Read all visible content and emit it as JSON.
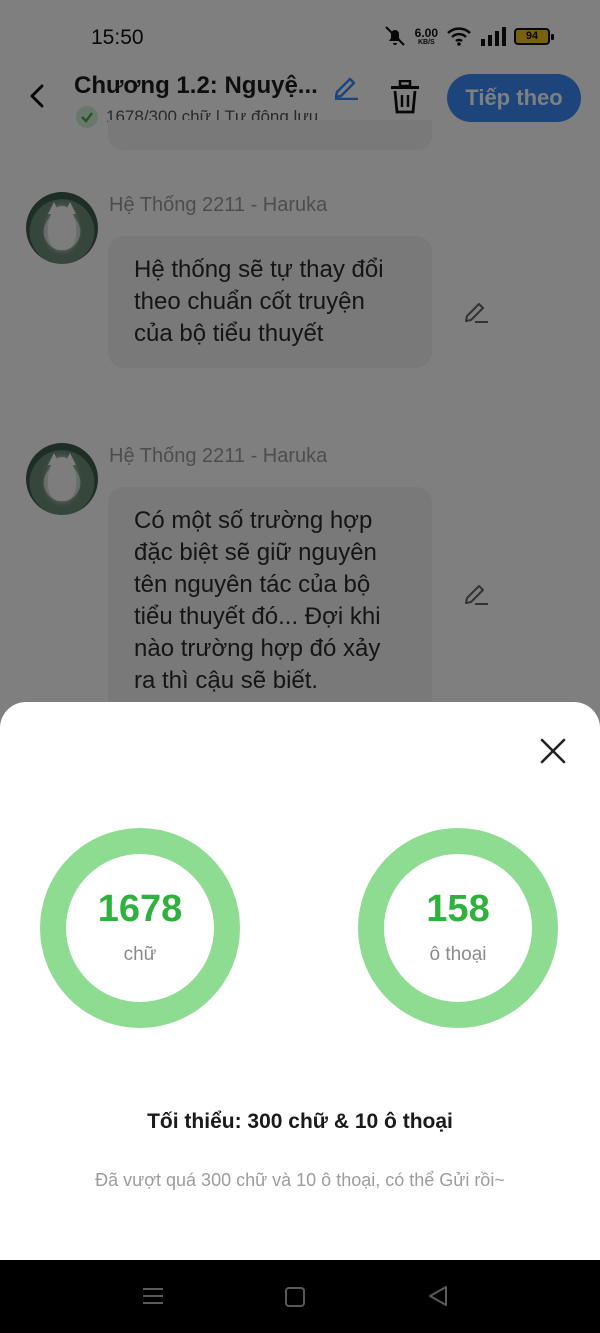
{
  "status_bar": {
    "time": "15:50",
    "net_speed_value": "6.00",
    "net_speed_unit": "KB/S",
    "battery": "94",
    "icons": [
      "mute-bell-icon",
      "wifi-icon",
      "signal-icon",
      "battery-icon"
    ]
  },
  "header": {
    "chapter_title": "Chương 1.2: Nguyệ...",
    "meta": "1678/300 chữ | Tự động lưu",
    "next_button": "Tiếp theo",
    "accent_color": "#3a8bf7"
  },
  "messages": [
    {
      "sender": "Hệ Thống 2211 - Haruka",
      "text": "Hệ thống sẽ tự thay đổi theo chuẩn cốt truyện của bộ tiểu thuyết"
    },
    {
      "sender": "Hệ Thống 2211 - Haruka",
      "text": "Có một số trường hợp đặc biệt sẽ giữ nguyên tên nguyên tác của bộ tiểu thuyết đó... Đợi khi nào trường hợp đó xảy ra thì cậu sẽ biết."
    }
  ],
  "sheet": {
    "stats": [
      {
        "value": "1678",
        "unit": "chữ"
      },
      {
        "value": "158",
        "unit": "ô thoại"
      }
    ],
    "ring_color": "#8edb92",
    "value_color": "#2fb23d",
    "minimum": "Tối thiểu: 300 chữ & 10 ô thoại",
    "hint": "Đã vượt quá 300 chữ và 10 ô thoại, có thể Gửi rồi~"
  }
}
